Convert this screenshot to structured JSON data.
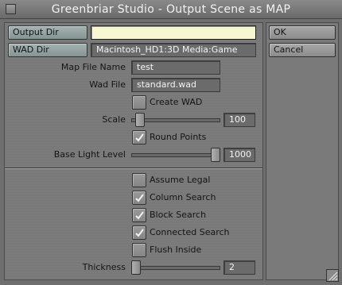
{
  "window": {
    "title": "Greenbriar Studio - Output Scene as MAP"
  },
  "paths": {
    "output_dir_label": "Output Dir",
    "output_dir_value": "",
    "wad_dir_label": "WAD Dir",
    "wad_dir_value": "Macintosh_HD1:3D Media:Game"
  },
  "actions": {
    "ok_label": "OK",
    "cancel_label": "Cancel"
  },
  "map_file": {
    "label": "Map File Name",
    "value": "test"
  },
  "wad_file": {
    "label": "Wad File",
    "value": "standard.wad"
  },
  "create_wad": {
    "label": "Create WAD",
    "checked": false
  },
  "scale": {
    "label": "Scale",
    "value": "100",
    "fraction": 0.05
  },
  "round_points": {
    "label": "Round Points",
    "checked": true
  },
  "base_light": {
    "label": "Base Light Level",
    "value": "1000",
    "fraction": 1.0
  },
  "options": [
    {
      "label": "Assume Legal",
      "checked": false
    },
    {
      "label": "Column Search",
      "checked": true
    },
    {
      "label": "Block Search",
      "checked": true
    },
    {
      "label": "Connected Search",
      "checked": true
    },
    {
      "label": "Flush Inside",
      "checked": false
    }
  ],
  "thickness": {
    "label": "Thickness",
    "value": "2",
    "fraction": 0.0
  },
  "icons": {
    "check": "checkmark-icon",
    "close": "close-box-icon",
    "resize": "resize-grip-icon"
  }
}
